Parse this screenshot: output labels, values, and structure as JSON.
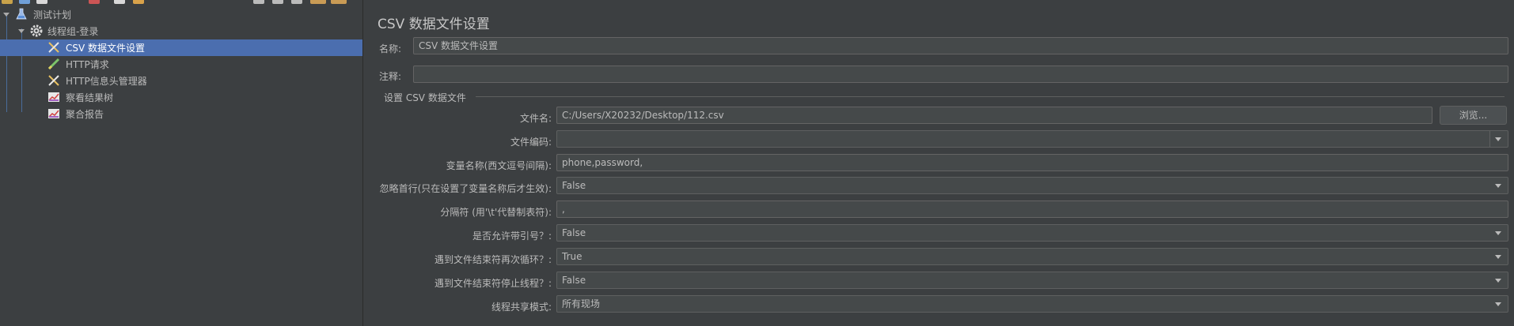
{
  "tree": {
    "items": [
      {
        "label": "测试计划",
        "icon": "flask-icon"
      },
      {
        "label": "线程组-登录",
        "icon": "gear-icon"
      },
      {
        "label": "CSV 数据文件设置",
        "icon": "scissors-icon"
      },
      {
        "label": "HTTP请求",
        "icon": "pencil-icon"
      },
      {
        "label": "HTTP信息头管理器",
        "icon": "scissors-icon"
      },
      {
        "label": "察看结果树",
        "icon": "chart-icon"
      },
      {
        "label": "聚合报告",
        "icon": "chart-icon"
      }
    ],
    "selected_index": 2
  },
  "panel": {
    "title": "CSV 数据文件设置",
    "name_label": "名称:",
    "name_value": "CSV 数据文件设置",
    "comment_label": "注释:",
    "comment_value": "",
    "group_title": "设置 CSV 数据文件",
    "filename_label": "文件名:",
    "filename_value": "C:/Users/X20232/Desktop/112.csv",
    "browse_label": "浏览...",
    "encoding_label": "文件编码:",
    "encoding_value": "",
    "varnames_label": "变量名称(西文逗号间隔):",
    "varnames_value": "phone,password,",
    "ignore_first_label": "忽略首行(只在设置了变量名称后才生效):",
    "ignore_first_value": "False",
    "delimiter_label": "分隔符 (用'\\t'代替制表符):",
    "delimiter_value": ",",
    "quoted_label": "是否允许带引号？:",
    "quoted_value": "False",
    "recycle_label": "遇到文件结束符再次循环？:",
    "recycle_value": "True",
    "stop_thread_label": "遇到文件结束符停止线程？:",
    "stop_thread_value": "False",
    "sharing_label": "线程共享模式:",
    "sharing_value": "所有现场"
  },
  "colors": {
    "background": "#3c3f41",
    "selection": "#4b6eaf",
    "field": "#45494a",
    "text": "#bbbbbb"
  }
}
